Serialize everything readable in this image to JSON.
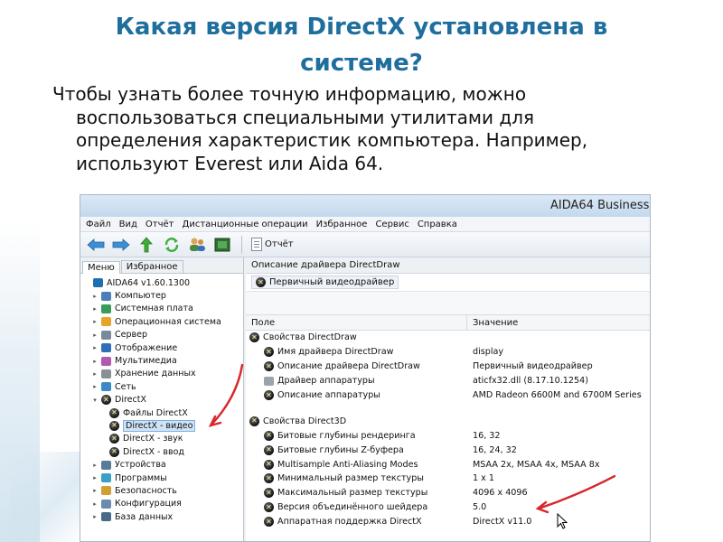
{
  "slide": {
    "title": "Какая версия DirectX установлена в системе?",
    "body_lines": [
      "Чтобы узнать более точную информацию, можно",
      "воспользоваться специальными утилитами для",
      "определения характеристик компьютера. Например,",
      "используют Everest или Aida 64."
    ]
  },
  "window": {
    "title": "AIDA64 Business",
    "menu": [
      "Файл",
      "Вид",
      "Отчёт",
      "Дистанционные операции",
      "Избранное",
      "Сервис",
      "Справка"
    ],
    "toolbar": {
      "report_label": "Отчёт"
    },
    "tabs": [
      "Меню",
      "Избранное"
    ],
    "tree": [
      {
        "label": "AIDA64 v1.60.1300",
        "icon": "aida-icon",
        "toggle": "",
        "level": 0
      },
      {
        "label": "Компьютер",
        "icon": "computer-icon",
        "toggle": "▸",
        "level": 1
      },
      {
        "label": "Системная плата",
        "icon": "motherboard-icon",
        "toggle": "▸",
        "level": 1
      },
      {
        "label": "Операционная система",
        "icon": "windows-icon",
        "toggle": "▸",
        "level": 1
      },
      {
        "label": "Сервер",
        "icon": "server-icon",
        "toggle": "▸",
        "level": 1
      },
      {
        "label": "Отображение",
        "icon": "display-icon",
        "toggle": "▸",
        "level": 1
      },
      {
        "label": "Мультимедиа",
        "icon": "multimedia-icon",
        "toggle": "▸",
        "level": 1
      },
      {
        "label": "Хранение данных",
        "icon": "storage-icon",
        "toggle": "▸",
        "level": 1
      },
      {
        "label": "Сеть",
        "icon": "network-icon",
        "toggle": "▸",
        "level": 1
      },
      {
        "label": "DirectX",
        "icon": "directx-icon",
        "toggle": "▾",
        "level": 1
      },
      {
        "label": "Файлы DirectX",
        "icon": "directx-icon",
        "toggle": "",
        "level": 2
      },
      {
        "label": "DirectX - видео",
        "icon": "directx-icon",
        "toggle": "",
        "level": 2,
        "selected": true
      },
      {
        "label": "DirectX - звук",
        "icon": "directx-icon",
        "toggle": "",
        "level": 2
      },
      {
        "label": "DirectX - ввод",
        "icon": "directx-icon",
        "toggle": "",
        "level": 2
      },
      {
        "label": "Устройства",
        "icon": "devices-icon",
        "toggle": "▸",
        "level": 1
      },
      {
        "label": "Программы",
        "icon": "programs-icon",
        "toggle": "▸",
        "level": 1
      },
      {
        "label": "Безопасность",
        "icon": "security-icon",
        "toggle": "▸",
        "level": 1
      },
      {
        "label": "Конфигурация",
        "icon": "config-icon",
        "toggle": "▸",
        "level": 1
      },
      {
        "label": "База данных",
        "icon": "database-icon",
        "toggle": "▸",
        "level": 1
      }
    ],
    "right": {
      "header": "Описание драйвера DirectDraw",
      "primary_driver": "Первичный видеодрайвер",
      "columns": [
        "Поле",
        "Значение"
      ],
      "sections": [
        {
          "title": "Свойства DirectDraw",
          "rows": [
            {
              "field": "Имя драйвера DirectDraw",
              "value": "display",
              "icon": "directx-icon"
            },
            {
              "field": "Описание драйвера DirectDraw",
              "value": "Первичный видеодрайвер",
              "icon": "directx-icon"
            },
            {
              "field": "Драйвер аппаратуры",
              "value": "aticfx32.dll (8.17.10.1254)",
              "icon": "driver-file-icon"
            },
            {
              "field": "Описание аппаратуры",
              "value": "AMD Radeon 6600M and 6700M Series",
              "icon": "directx-icon"
            }
          ]
        },
        {
          "title": "Свойства Direct3D",
          "rows": [
            {
              "field": "Битовые глубины рендеринга",
              "value": "16, 32",
              "icon": "directx-icon"
            },
            {
              "field": "Битовые глубины Z-буфера",
              "value": "16, 24, 32",
              "icon": "directx-icon"
            },
            {
              "field": "Multisample Anti-Aliasing Modes",
              "value": "MSAA 2x, MSAA 4x, MSAA 8x",
              "icon": "directx-icon"
            },
            {
              "field": "Минимальный размер текстуры",
              "value": "1 x 1",
              "icon": "directx-icon"
            },
            {
              "field": "Максимальный размер текстуры",
              "value": "4096 x 4096",
              "icon": "directx-icon"
            },
            {
              "field": "Версия объединённого шейдера",
              "value": "5.0",
              "icon": "directx-icon"
            },
            {
              "field": "Аппаратная поддержка DirectX",
              "value": "DirectX v11.0",
              "icon": "directx-icon"
            }
          ]
        }
      ]
    }
  },
  "colors": {
    "title": "#1e6e9e",
    "annotation_arrow": "#d9262b",
    "selection": "#cfe3f7"
  }
}
